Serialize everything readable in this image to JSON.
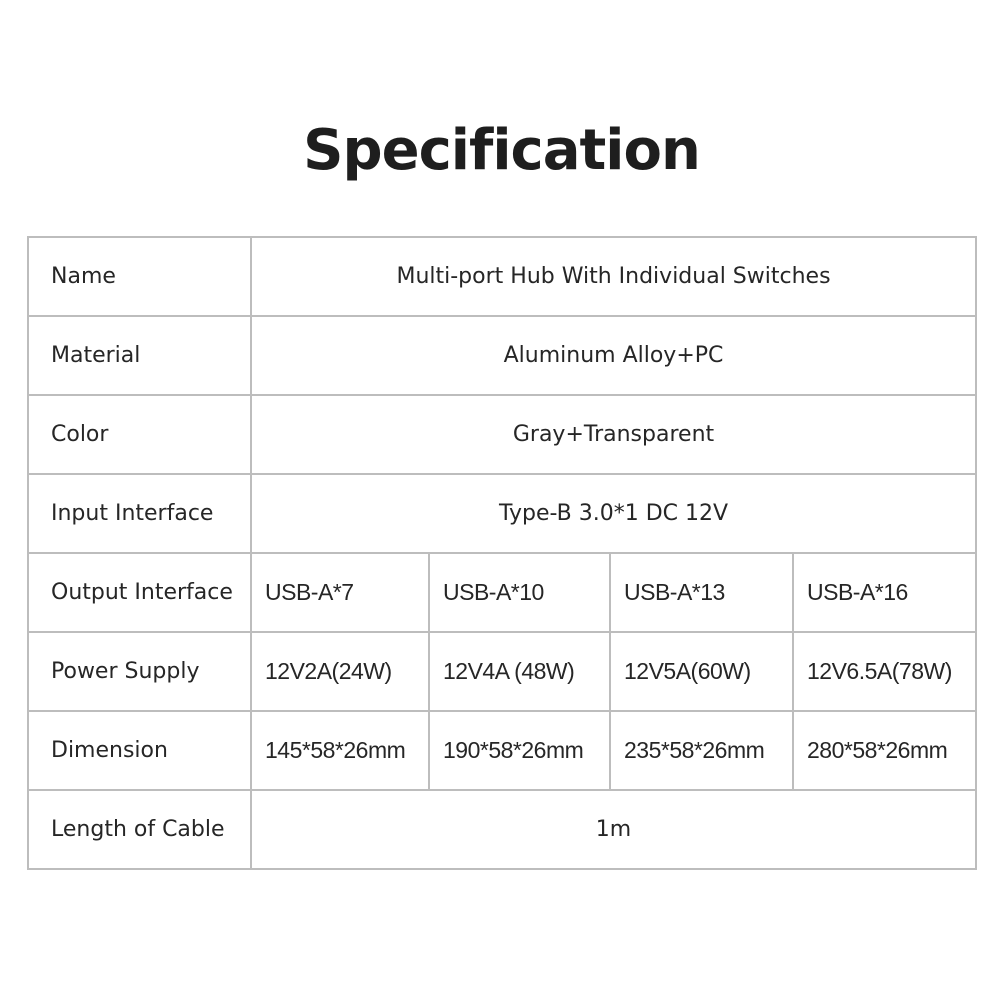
{
  "title": "Specification",
  "rows": {
    "name": {
      "label": "Name",
      "value": "Multi-port Hub With Individual Switches"
    },
    "material": {
      "label": "Material",
      "value": "Aluminum Alloy+PC"
    },
    "color": {
      "label": "Color",
      "value": "Gray+Transparent"
    },
    "input_interface": {
      "label": "Input Interface",
      "value": "Type-B 3.0*1  DC 12V"
    },
    "output_interface": {
      "label": "Output Interface",
      "values": [
        "USB-A*7",
        "USB-A*10",
        "USB-A*13",
        "USB-A*16"
      ]
    },
    "power_supply": {
      "label": "Power Supply",
      "values": [
        "12V2A(24W)",
        "12V4A (48W)",
        "12V5A(60W)",
        "12V6.5A(78W)"
      ]
    },
    "dimension": {
      "label": "Dimension",
      "values": [
        "145*58*26mm",
        "190*58*26mm",
        "235*58*26mm",
        "280*58*26mm"
      ]
    },
    "cable_length": {
      "label": "Length of Cable",
      "value": "1m"
    }
  }
}
